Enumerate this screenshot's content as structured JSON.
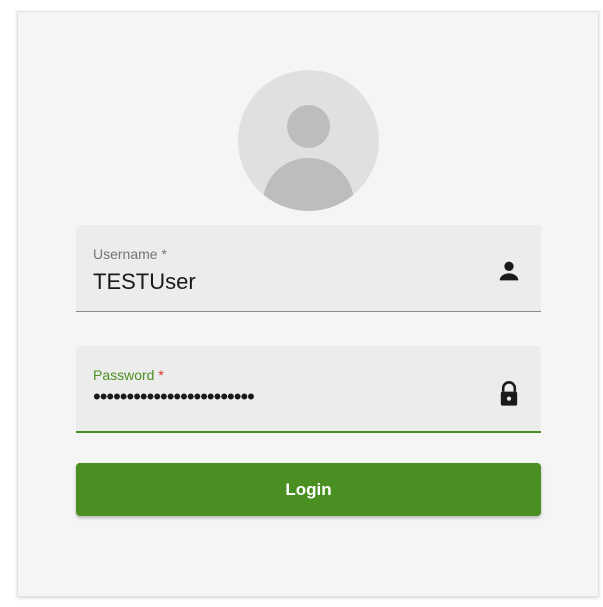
{
  "login": {
    "username": {
      "label": "Username",
      "required_marker": " *",
      "value": "TESTUser",
      "icon": "person-icon"
    },
    "password": {
      "label": "Password",
      "required_marker": " *",
      "value": "••••••••••••••••••••••••",
      "icon": "lock-icon"
    },
    "submit_label": "Login"
  },
  "colors": {
    "accent": "#4a8f21",
    "required": "#d32f2f",
    "card_background": "#f5f5f5",
    "field_background": "#ececec"
  }
}
